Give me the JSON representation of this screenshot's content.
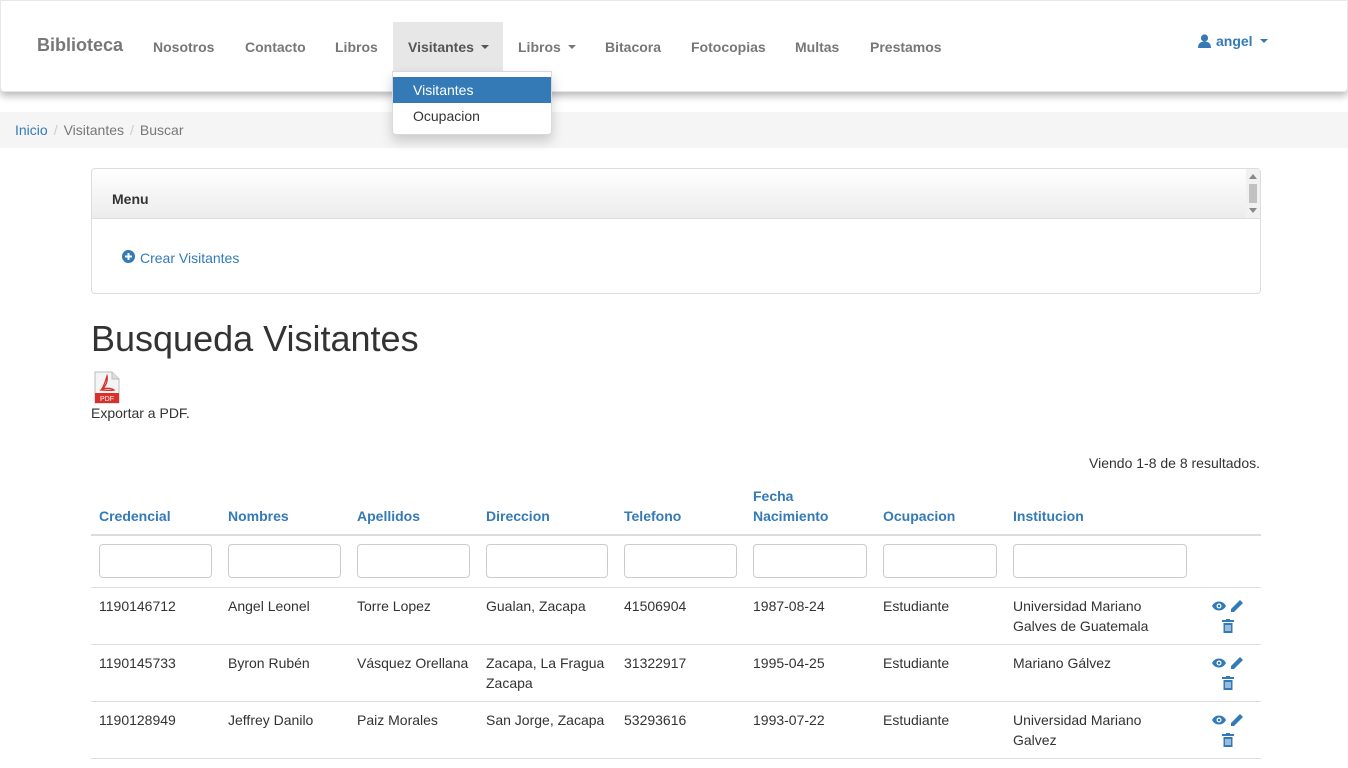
{
  "navbar": {
    "brand": "Biblioteca",
    "items": [
      {
        "label": "Nosotros"
      },
      {
        "label": "Contacto"
      },
      {
        "label": "Libros"
      },
      {
        "label": "Visitantes"
      },
      {
        "label": "Libros"
      },
      {
        "label": "Bitacora"
      },
      {
        "label": "Fotocopias"
      },
      {
        "label": "Multas"
      },
      {
        "label": "Prestamos"
      }
    ],
    "user": "angel"
  },
  "dropdown": {
    "items": [
      {
        "label": "Visitantes"
      },
      {
        "label": "Ocupacion"
      }
    ]
  },
  "breadcrumb": {
    "items": [
      {
        "label": "Inicio"
      },
      {
        "label": "Visitantes"
      },
      {
        "label": "Buscar"
      }
    ]
  },
  "panel": {
    "heading": "Menu",
    "create_link": "Crear Visitantes"
  },
  "page": {
    "title": "Busqueda Visitantes",
    "pdf_icon_text": "PDF",
    "export_label": "Exportar a PDF.",
    "summary": "Viendo 1-8 de 8 resultados."
  },
  "table": {
    "columns": [
      "Credencial",
      "Nombres",
      "Apellidos",
      "Direccion",
      "Telefono",
      "Fecha Nacimiento",
      "Ocupacion",
      "Institucion"
    ],
    "rows": [
      {
        "credencial": "1190146712",
        "nombres": "Angel Leonel",
        "apellidos": "Torre Lopez",
        "direccion": "Gualan, Zacapa",
        "telefono": "41506904",
        "fecha": "1987-08-24",
        "ocupacion": "Estudiante",
        "institucion": "Universidad Mariano Galves de Guatemala"
      },
      {
        "credencial": "1190145733",
        "nombres": "Byron Rubén",
        "apellidos": "Vásquez Orellana",
        "direccion": "Zacapa, La Fragua Zacapa",
        "telefono": "31322917",
        "fecha": "1995-04-25",
        "ocupacion": "Estudiante",
        "institucion": "Mariano Gálvez"
      },
      {
        "credencial": "1190128949",
        "nombres": "Jeffrey Danilo",
        "apellidos": "Paiz Morales",
        "direccion": "San Jorge, Zacapa",
        "telefono": "53293616",
        "fecha": "1993-07-22",
        "ocupacion": "Estudiante",
        "institucion": "Universidad Mariano Galvez"
      }
    ]
  },
  "colors": {
    "link": "#337ab7",
    "nav_text": "#777777",
    "active_nav_bg": "#e7e7e7",
    "pdf_red": "#d9302c"
  }
}
